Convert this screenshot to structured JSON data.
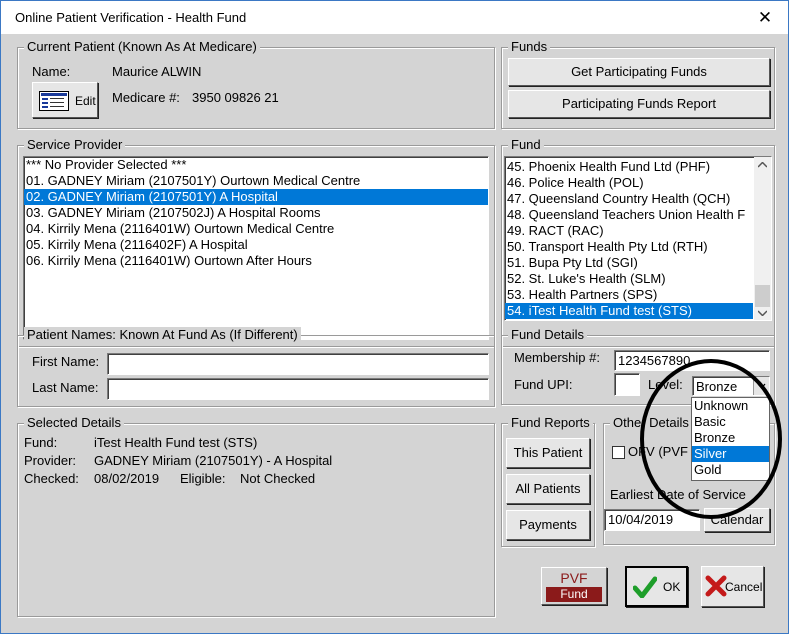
{
  "window": {
    "title": "Online Patient Verification - Health Fund",
    "close_glyph": "✕"
  },
  "current_patient": {
    "label": "Current Patient  (Known As At Medicare)",
    "name_label": "Name:",
    "name_value": "Maurice ALWIN",
    "medicare_label": "Medicare #:",
    "medicare_value": "3950 09826 21",
    "edit_label": "Edit"
  },
  "funds": {
    "label": "Funds",
    "get_participating": "Get Participating Funds",
    "participating_report": "Participating Funds Report"
  },
  "service_provider": {
    "label": "Service Provider",
    "items": [
      "*** No Provider Selected ***",
      "01. GADNEY Miriam (2107501Y) Ourtown Medical Centre",
      "02. GADNEY Miriam (2107501Y) A Hospital",
      "03. GADNEY Miriam (2107502J) A Hospital Rooms",
      "04. Kirrily Mena (2116401W) Ourtown Medical Centre",
      "05. Kirrily Mena (2116402F) A Hospital",
      "06. Kirrily Mena (2116401W) Ourtown After Hours"
    ]
  },
  "fund": {
    "label": "Fund",
    "items": [
      "45. Phoenix Health Fund Ltd (PHF)",
      "46. Police Health (POL)",
      "47. Queensland Country Health (QCH)",
      "48. Queensland Teachers Union Health F",
      "49. RACT (RAC)",
      "50. Transport Health Pty Ltd (RTH)",
      "51. Bupa Pty Ltd (SGI)",
      "52. St. Luke's Health (SLM)",
      "53. Health Partners (SPS)",
      "54. iTest Health Fund test (STS)"
    ]
  },
  "patient_names": {
    "label": "Patient Names: Known At Fund As  (If Different)",
    "first_label": "First Name:",
    "first_value": "",
    "last_label": "Last Name:",
    "last_value": ""
  },
  "fund_details": {
    "label": "Fund Details",
    "membership_label": "Membership #:",
    "membership_value": "1234567890",
    "upi_label": "Fund UPI:",
    "upi_value": "",
    "level_label": "Level:",
    "level_value": "Bronze",
    "level_options": [
      "Unknown",
      "Basic",
      "Bronze",
      "Silver",
      "Gold"
    ]
  },
  "selected_details": {
    "label": "Selected Details",
    "fund_label": "Fund:",
    "fund_value": "iTest Health Fund test  (STS)",
    "provider_label": "Provider:",
    "provider_value": "GADNEY Miriam (2107501Y) - A Hospital",
    "checked_label": "Checked:",
    "checked_value": "08/02/2019",
    "eligible_label": "Eligible:",
    "eligible_value": "Not Checked"
  },
  "fund_reports": {
    "label": "Fund Reports",
    "this_patient": "This Patient",
    "all_patients": "All Patients",
    "payments": "Payments"
  },
  "other_details": {
    "label": "Other Details",
    "ofv_label": "OFV (PVF",
    "earliest_label": "Earliest Date of Service",
    "earliest_value": "10/04/2019",
    "calendar_label": "Calendar"
  },
  "footer": {
    "pvf_top": "PVF",
    "pvf_bottom": "Fund",
    "ok_label": "OK",
    "cancel_label": "Cancel"
  },
  "colors": {
    "selection": "#0078d7",
    "background": "#d4d4d4",
    "pvf": "#8b1a1a"
  }
}
